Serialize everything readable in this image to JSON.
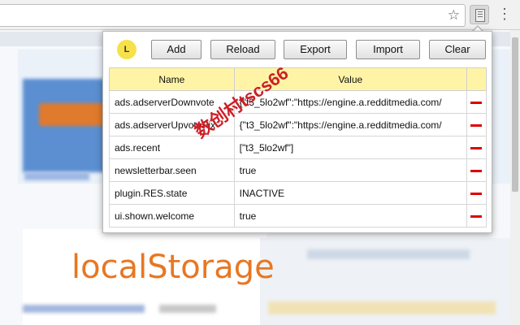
{
  "browser": {
    "star_icon": "star-icon",
    "extension_icon": "storage-icon",
    "menu_icon": "more-vert-icon"
  },
  "popup": {
    "logo_letter": "L",
    "buttons": {
      "add": "Add",
      "reload": "Reload",
      "export": "Export",
      "import": "Import",
      "clear": "Clear"
    },
    "table": {
      "columns": [
        "Name",
        "Value"
      ],
      "rows": [
        {
          "name": "ads.adserverDownvote",
          "value": "{\"t3_5lo2wf\":\"https://engine.a.redditmedia.com/"
        },
        {
          "name": "ads.adserverUpvotePix",
          "value": "{\"t3_5lo2wf\":\"https://engine.a.redditmedia.com/"
        },
        {
          "name": "ads.recent",
          "value": "[\"t3_5lo2wf\"]"
        },
        {
          "name": "newsletterbar.seen",
          "value": "true"
        },
        {
          "name": "plugin.RES.state",
          "value": "INACTIVE"
        },
        {
          "name": "ui.shown.welcome",
          "value": "true"
        }
      ],
      "delete_icon": "minus-icon"
    }
  },
  "caption": "localStorage",
  "watermark": "数创村tscs66",
  "colors": {
    "header_bg": "#fff4a6",
    "delete_red": "#dd0000",
    "caption_orange": "#e87722",
    "logo_yellow": "#f7e14a"
  }
}
